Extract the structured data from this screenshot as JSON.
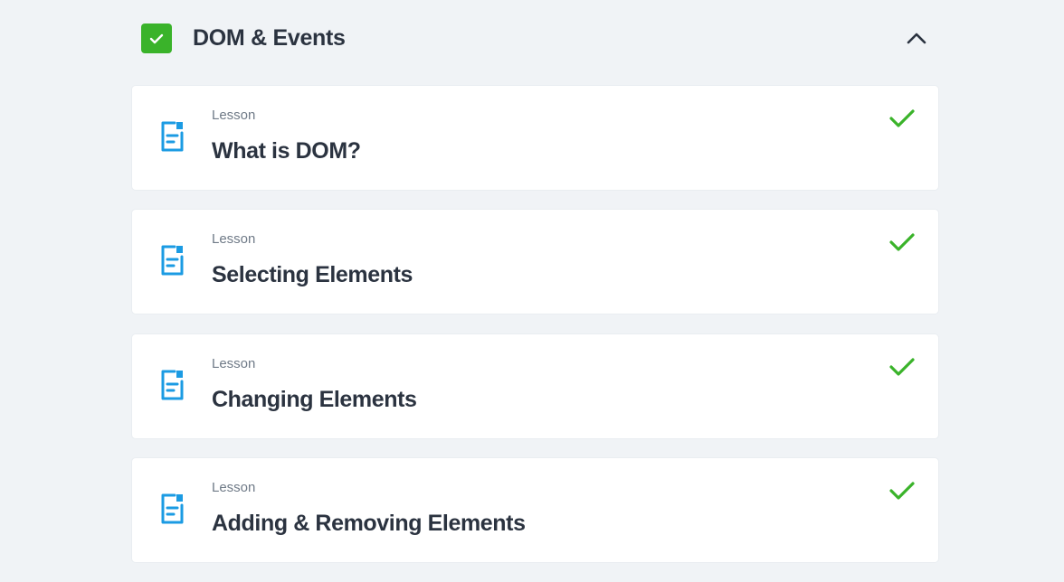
{
  "section": {
    "title": "DOM & Events",
    "completed": true,
    "expanded": true
  },
  "lessons": [
    {
      "type": "Lesson",
      "title": "What is DOM?",
      "completed": true
    },
    {
      "type": "Lesson",
      "title": "Selecting Elements",
      "completed": true
    },
    {
      "type": "Lesson",
      "title": "Changing Elements",
      "completed": true
    },
    {
      "type": "Lesson",
      "title": "Adding & Removing Elements",
      "completed": true
    }
  ],
  "colors": {
    "page_bg": "#f0f3f6",
    "card_bg": "#ffffff",
    "complete_green": "#3ab32a",
    "lesson_icon_blue": "#1b9be3",
    "title_text": "#2b3340",
    "meta_text": "#6f7a87"
  },
  "icons": {
    "section_status": "checkbox-checked-icon",
    "section_toggle": "chevron-up-icon",
    "lesson_type": "document-icon",
    "lesson_status": "checkmark-icon"
  }
}
